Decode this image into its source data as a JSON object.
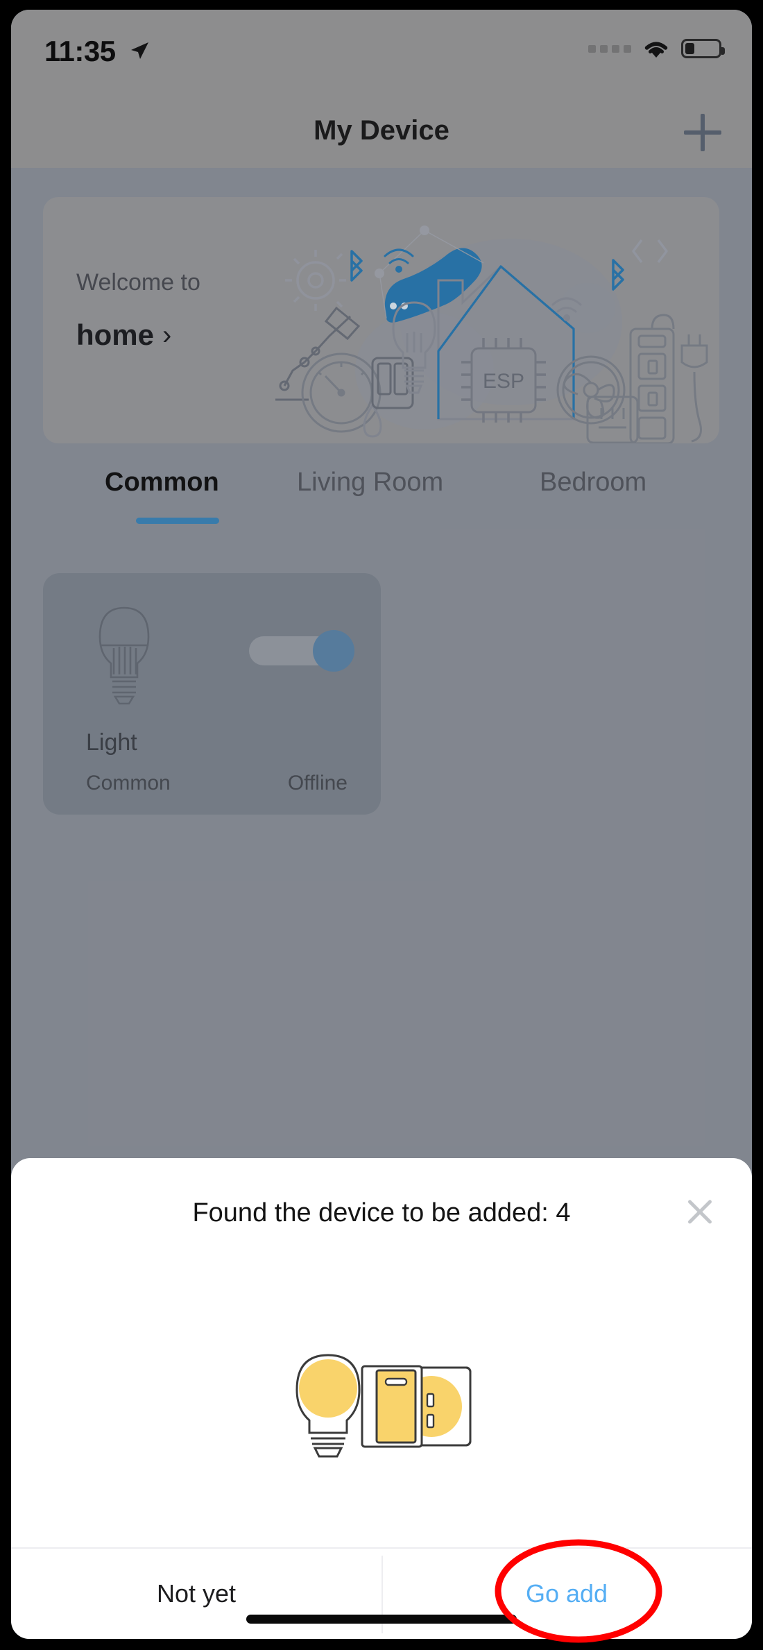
{
  "status_bar": {
    "time": "11:35",
    "location_icon": "location-arrow-icon",
    "signal_icon": "signal-dots-icon",
    "wifi_icon": "wifi-icon",
    "battery_icon": "battery-low-icon"
  },
  "header": {
    "title": "My Device",
    "add_icon": "plus-icon"
  },
  "banner": {
    "welcome_label": "Welcome to",
    "home_name": "home",
    "chevron": "›",
    "illustration": "smart-home-esp-illustration",
    "chip_label": "ESP"
  },
  "tabs": [
    {
      "label": "Common",
      "active": true
    },
    {
      "label": "Living Room",
      "active": false
    },
    {
      "label": "Bedroom",
      "active": false
    }
  ],
  "device_card": {
    "icon": "light-bulb-icon",
    "name": "Light",
    "room": "Common",
    "status": "Offline",
    "toggle_state": "on"
  },
  "sheet": {
    "title": "Found the device to be added: 4",
    "close_icon": "close-icon",
    "illustration": "bulb-switch-outlet-illustration",
    "buttons": {
      "secondary": "Not yet",
      "primary": "Go add"
    }
  },
  "annotation": {
    "shape": "red-ellipse-highlight",
    "color": "#ff0000",
    "targets": "Go add"
  },
  "colors": {
    "page_background": "#8e939c",
    "header_background": "#9b9b9b",
    "banner_background": "#9a9b9e",
    "card_background": "#7f8791",
    "accent_blue": "#3d87bc",
    "link_blue": "#55aef4",
    "sheet_background": "#ffffff",
    "illustration_yellow": "#f9d36b"
  }
}
